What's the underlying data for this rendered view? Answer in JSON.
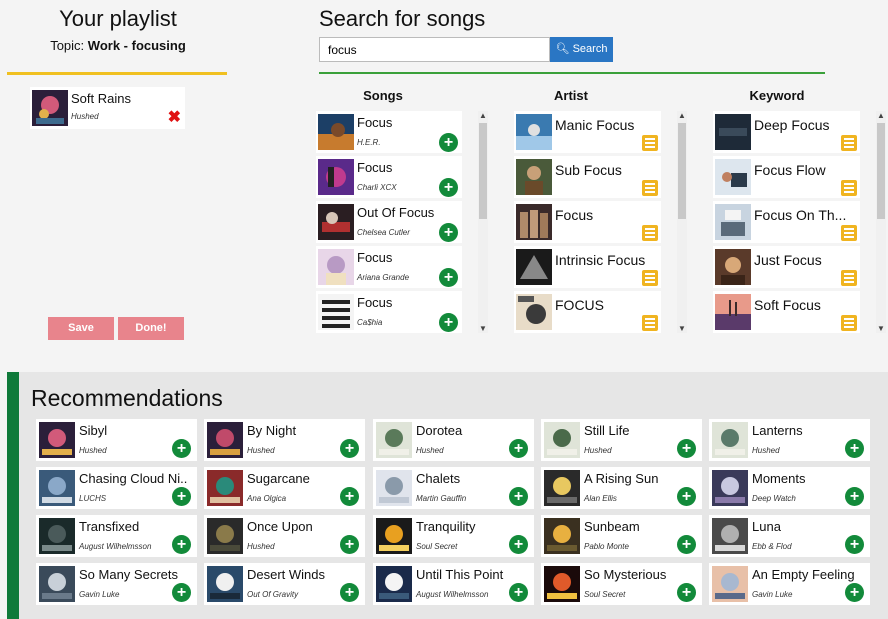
{
  "playlist": {
    "title": "Your playlist",
    "topic_label": "Topic:",
    "topic_value": "Work - focusing",
    "items": [
      {
        "title": "Soft Rains",
        "artist": "Hushed"
      }
    ],
    "save_label": "Save",
    "done_label": "Done!"
  },
  "search": {
    "title": "Search for songs",
    "query": "focus",
    "button_label": "Search"
  },
  "columns": {
    "songs": {
      "header": "Songs",
      "items": [
        {
          "title": "Focus",
          "artist": "H.E.R."
        },
        {
          "title": "Focus",
          "artist": "Charli XCX"
        },
        {
          "title": "Out Of Focus",
          "artist": "Chelsea Cutler"
        },
        {
          "title": "Focus",
          "artist": "Ariana Grande"
        },
        {
          "title": "Focus",
          "artist": "Ca$hia"
        }
      ]
    },
    "artist": {
      "header": "Artist",
      "items": [
        {
          "title": "Manic Focus"
        },
        {
          "title": "Sub Focus"
        },
        {
          "title": "Focus"
        },
        {
          "title": "Intrinsic Focus"
        },
        {
          "title": "FOCUS"
        }
      ]
    },
    "keyword": {
      "header": "Keyword",
      "items": [
        {
          "title": "Deep Focus"
        },
        {
          "title": "Focus Flow"
        },
        {
          "title": "Focus On Th..."
        },
        {
          "title": "Just Focus"
        },
        {
          "title": "Soft Focus"
        }
      ]
    }
  },
  "recommendations": {
    "title": "Recommendations",
    "rows": [
      [
        {
          "title": "Sibyl",
          "artist": "Hushed"
        },
        {
          "title": "By Night",
          "artist": "Hushed"
        },
        {
          "title": "Dorotea",
          "artist": "Hushed"
        },
        {
          "title": "Still Life",
          "artist": "Hushed"
        },
        {
          "title": "Lanterns",
          "artist": "Hushed"
        }
      ],
      [
        {
          "title": "Chasing Cloud Ni...",
          "artist": "LUCHS"
        },
        {
          "title": "Sugarcane",
          "artist": "Ana Olgica"
        },
        {
          "title": "Chalets",
          "artist": "Martin Gauffin"
        },
        {
          "title": "A Rising Sun",
          "artist": "Alan Ellis"
        },
        {
          "title": "Moments",
          "artist": "Deep Watch"
        }
      ],
      [
        {
          "title": "Transfixed",
          "artist": "August Wilhelmsson"
        },
        {
          "title": "Once Upon",
          "artist": "Hushed"
        },
        {
          "title": "Tranquility",
          "artist": "Soul Secret"
        },
        {
          "title": "Sunbeam",
          "artist": "Pablo Monte"
        },
        {
          "title": "Luna",
          "artist": "Ebb & Flod"
        }
      ],
      [
        {
          "title": "So Many Secrets",
          "artist": "Gavin Luke"
        },
        {
          "title": "Desert Winds",
          "artist": "Out Of Gravity"
        },
        {
          "title": "Until This Point",
          "artist": "August Wilhelmsson"
        },
        {
          "title": "So Mysterious",
          "artist": "Soul Secret"
        },
        {
          "title": "An Empty Feeling",
          "artist": "Gavin Luke"
        }
      ]
    ]
  },
  "colors": {
    "accent_yellow": "#f0c020",
    "accent_green": "#128a3a",
    "search_blue": "#2a76c4",
    "remove_red": "#e01010",
    "button_pink": "#e8848c"
  }
}
